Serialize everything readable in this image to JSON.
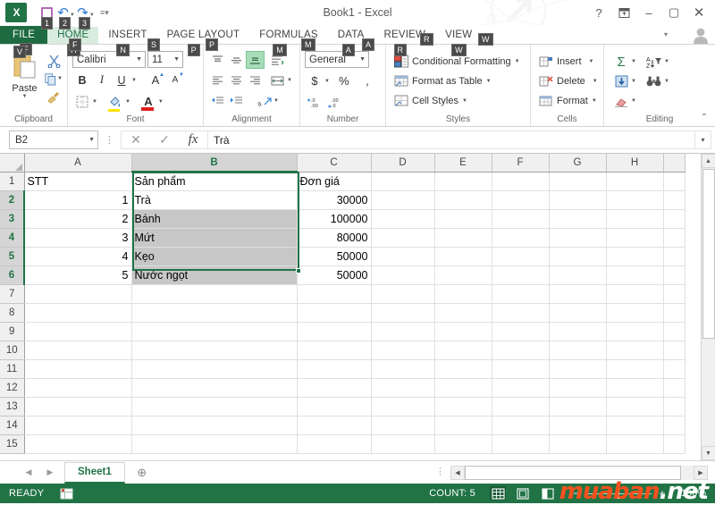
{
  "window": {
    "title": "Book1 - Excel",
    "logo": "excel-logo",
    "help_icon": "?",
    "ribbon_display_icon": "ribbon-display-options",
    "minimize_icon": "–",
    "maximize_icon": "▢",
    "close_icon": "✕",
    "account_icon": "user-account"
  },
  "quick_access": {
    "items": [
      {
        "name": "save",
        "icon": "save-icon",
        "keytip": "1"
      },
      {
        "name": "undo",
        "icon": "undo-icon",
        "keytip": "2"
      },
      {
        "name": "redo",
        "icon": "redo-icon",
        "keytip": "3"
      }
    ],
    "customize_icon": "customize-quick-access-icon"
  },
  "ribbon": {
    "tabs": [
      {
        "label": "FILE",
        "keytip": "F",
        "active": false,
        "file": true
      },
      {
        "label": "HOME",
        "keytip": "H",
        "active": true
      },
      {
        "label": "INSERT",
        "keytip": "N",
        "active": false
      },
      {
        "label": "PAGE LAYOUT",
        "keytip": "P",
        "active": false
      },
      {
        "label": "FORMULAS",
        "keytip": "M",
        "active": false
      },
      {
        "label": "DATA",
        "keytip": "A",
        "active": false
      },
      {
        "label": "REVIEW",
        "keytip": "R",
        "active": false
      },
      {
        "label": "VIEW",
        "keytip": "W",
        "active": false
      }
    ],
    "collapse_icon": "collapse-ribbon-icon",
    "groups": {
      "clipboard": {
        "label": "Clipboard",
        "paste_label": "Paste",
        "cut_label": "Cut",
        "copy_label": "Copy",
        "format_painter_label": "Format Painter"
      },
      "font": {
        "label": "Font",
        "font_name": "Calibri",
        "font_size": "11",
        "bold": "B",
        "italic": "I",
        "underline": "U",
        "grow_font": "A",
        "shrink_font": "A",
        "borders_label": "Borders",
        "fill_color_label": "Fill Color",
        "font_color_label": "Font Color"
      },
      "alignment": {
        "label": "Alignment",
        "top_align": "Top Align",
        "middle_align": "Middle Align",
        "bottom_align": "Bottom Align",
        "align_left": "Align Left",
        "center": "Center",
        "align_right": "Align Right",
        "wrap_text": "Wrap Text",
        "merge_center": "Merge & Center",
        "decrease_indent": "Decrease Indent",
        "increase_indent": "Increase Indent",
        "orientation": "Orientation"
      },
      "number": {
        "label": "Number",
        "format": "General",
        "accounting": "$",
        "percent": "%",
        "comma": ",",
        "increase_decimal": "Increase Decimal",
        "decrease_decimal": "Decrease Decimal"
      },
      "styles": {
        "label": "Styles",
        "items": [
          {
            "label": "Conditional Formatting",
            "icon": "conditional-formatting-icon"
          },
          {
            "label": "Format as Table",
            "icon": "format-as-table-icon"
          },
          {
            "label": "Cell Styles",
            "icon": "cell-styles-icon"
          }
        ]
      },
      "cells": {
        "label": "Cells",
        "items": [
          {
            "label": "Insert",
            "icon": "insert-cells-icon"
          },
          {
            "label": "Delete",
            "icon": "delete-cells-icon"
          },
          {
            "label": "Format",
            "icon": "format-cells-icon"
          }
        ]
      },
      "editing": {
        "label": "Editing",
        "autosum": "Σ",
        "fill": "Fill",
        "clear": "Clear",
        "sort_filter": "Sort & Filter",
        "find_select": "Find & Select"
      }
    }
  },
  "formula_bar": {
    "name_box": "B2",
    "cancel_icon": "✕",
    "enter_icon": "✓",
    "function_icon": "fx",
    "value": "Trà",
    "expand_icon": "▾"
  },
  "grid": {
    "columns": [
      "A",
      "B",
      "C",
      "D",
      "E",
      "F",
      "G",
      "H"
    ],
    "selected_column": "B",
    "rows": [
      1,
      2,
      3,
      4,
      5,
      6,
      7,
      8,
      9,
      10,
      11,
      12,
      13,
      14,
      15
    ],
    "selected_rows": [
      2,
      3,
      4,
      5,
      6
    ],
    "active_cell": "B2",
    "selection_range": "B2:B6",
    "data": [
      {
        "row": 1,
        "A": "STT",
        "B": "Sản phẩm",
        "C": "Đơn giá"
      },
      {
        "row": 2,
        "A": "1",
        "B": "Trà",
        "C": "30000"
      },
      {
        "row": 3,
        "A": "2",
        "B": "Bánh",
        "C": "100000"
      },
      {
        "row": 4,
        "A": "3",
        "B": "Mứt",
        "C": "80000"
      },
      {
        "row": 5,
        "A": "4",
        "B": "Kẹo",
        "C": "50000"
      },
      {
        "row": 6,
        "A": "5",
        "B": "Nước ngọt",
        "C": "50000"
      }
    ],
    "scroll_up_icon": "▲",
    "scroll_down_icon": "▼",
    "scroll_left_icon": "◀",
    "scroll_right_icon": "▶"
  },
  "sheet_tabs": {
    "first_icon": "◀",
    "last_icon": "▶",
    "tabs": [
      {
        "label": "Sheet1",
        "active": true
      }
    ],
    "add_sheet_icon": "⊕"
  },
  "status_bar": {
    "mode": "READY",
    "macro_icon": "record-macro-icon",
    "count_label": "COUNT: 5",
    "views": [
      {
        "name": "normal-view",
        "icon": "grid-icon",
        "active": true
      },
      {
        "name": "page-layout-view",
        "icon": "page-icon",
        "active": false
      },
      {
        "name": "page-break-preview",
        "icon": "break-icon",
        "active": false
      }
    ],
    "zoom_minus": "−",
    "zoom_plus": "+",
    "zoom_level": "100%"
  },
  "watermark": {
    "text_primary": "muaban",
    "text_secondary": ".net"
  },
  "colors": {
    "accent": "#217346",
    "file_tab": "#1e6b41",
    "active_tab_bg": "#d9ecdf",
    "selection_fill": "#c7c7c7",
    "header_sel": "#d5d5d5",
    "watermark": "#f4511e"
  }
}
